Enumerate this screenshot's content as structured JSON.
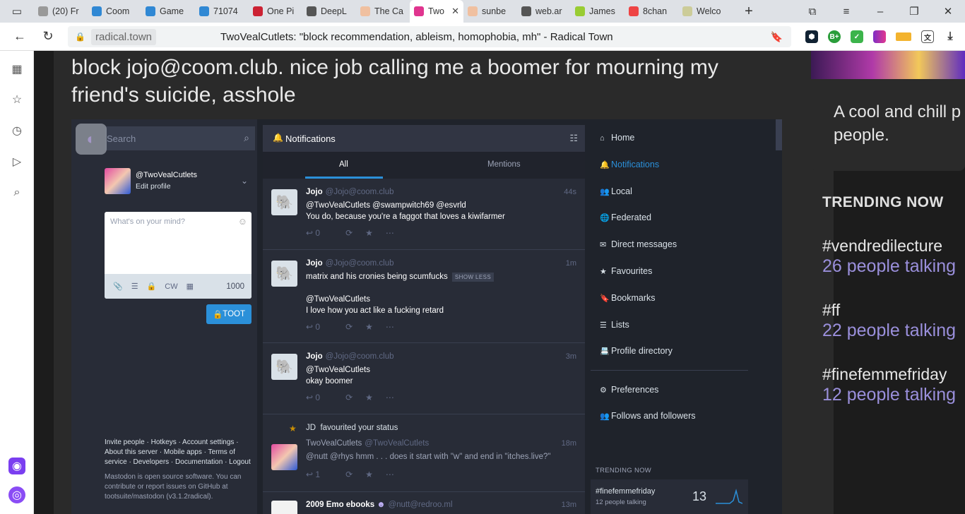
{
  "browser": {
    "tabs": [
      {
        "title": "(20) Fr",
        "color": "#999"
      },
      {
        "title": "Coom",
        "color": "#3088d4"
      },
      {
        "title": "Game",
        "color": "#3088d4"
      },
      {
        "title": "71074",
        "color": "#3088d4"
      },
      {
        "title": "One Pi",
        "color": "#c23"
      },
      {
        "title": "DeepL",
        "color": "#555"
      },
      {
        "title": "The Ca",
        "color": "#f0c0a0"
      },
      {
        "title": "Two",
        "color": "#e0358f"
      },
      {
        "title": "sunbe",
        "color": "#f0c0a0"
      },
      {
        "title": "web.ar",
        "color": "#555"
      },
      {
        "title": "James",
        "color": "#9c3"
      },
      {
        "title": "8chan",
        "color": "#e44"
      },
      {
        "title": "Welco",
        "color": "#cc9"
      }
    ],
    "url_domain": "radical.town",
    "page_title": "TwoVealCutlets: \"block recommendation, ableism, homophobia, mh\" - Radical Town"
  },
  "post": {
    "text": "block jojo@coom.club. nice job calling me a boomer for mourning my friend's suicide, asshole"
  },
  "mastodon": {
    "search_placeholder": "Search",
    "handle": "@TwoVealCutlets",
    "edit_profile": "Edit profile",
    "compose_placeholder": "What's on your mind?",
    "cw": "CW",
    "char_count": "1000",
    "toot_button": "TOOT",
    "footer_links": "Invite people · Hotkeys · Account settings · About this server · Mobile apps · Terms of service · Developers · Documentation · Logout",
    "footer_note": "Mastodon is open source software. You can contribute or report issues on GitHub at tootsuite/mastodon (v3.1.2radical).",
    "column_title": "Notifications",
    "tab_all": "All",
    "tab_mentions": "Mentions",
    "notifications": [
      {
        "name": "Jojo",
        "acct": "@Jojo@coom.club",
        "time": "44s",
        "line1": "@TwoVealCutlets @swampwitch69 @esvrld",
        "line2": "You do, because you're a faggot that loves a kiwifarmer",
        "replies": "0"
      },
      {
        "name": "Jojo",
        "acct": "@Jojo@coom.club",
        "time": "1m",
        "line1": "matrix and his cronies being scumfucks",
        "show_less": "SHOW LESS",
        "line2": "@TwoVealCutlets",
        "line3": "I love how you act like a fucking retard",
        "replies": "0"
      },
      {
        "name": "Jojo",
        "acct": "@Jojo@coom.club",
        "time": "3m",
        "line1": "@TwoVealCutlets",
        "line2": "okay boomer",
        "replies": "0"
      },
      {
        "fav_by": "JD",
        "fav_text": "favourited your status",
        "name": "TwoVealCutlets",
        "acct": "@TwoVealCutlets",
        "time": "18m",
        "line1": "@nutt @rhys hmm . . . does it start with \"w\" and end in \"itches.live?\"",
        "replies": "1"
      },
      {
        "name": "2009 Emo ebooks",
        "acct": "@nutt@redroo.ml",
        "time": "13m"
      }
    ],
    "nav": [
      {
        "label": "Home",
        "icon": "home-icon",
        "glyph": "⌂"
      },
      {
        "label": "Notifications",
        "icon": "bell-icon",
        "glyph": "🔔"
      },
      {
        "label": "Local",
        "icon": "users-icon",
        "glyph": "👥"
      },
      {
        "label": "Federated",
        "icon": "globe-icon",
        "glyph": "🌐"
      },
      {
        "label": "Direct messages",
        "icon": "envelope-icon",
        "glyph": "✉"
      },
      {
        "label": "Favourites",
        "icon": "star-icon",
        "glyph": "★"
      },
      {
        "label": "Bookmarks",
        "icon": "bookmark-icon",
        "glyph": "🔖"
      },
      {
        "label": "Lists",
        "icon": "list-icon",
        "glyph": "☰"
      },
      {
        "label": "Profile directory",
        "icon": "address-book-icon",
        "glyph": "📇"
      },
      {
        "label": "Preferences",
        "icon": "cog-icon",
        "glyph": "⚙"
      },
      {
        "label": "Follows and followers",
        "icon": "users-icon",
        "glyph": "👥"
      }
    ],
    "trending_header": "TRENDING NOW",
    "trending_tag": "#finefemmefriday",
    "trending_sub": "12 people talking",
    "trending_count": "13"
  },
  "sidebar_right": {
    "about_text": "A cool and chill p\npeople.",
    "trending_header": "TRENDING NOW",
    "trends": [
      {
        "tag": "#vendredilecture",
        "sub": "26 people talking"
      },
      {
        "tag": "#ff",
        "sub": "22 people talking"
      },
      {
        "tag": "#finefemmefriday",
        "sub": "12 people talking"
      }
    ]
  },
  "colors": {
    "accent": "#2b90d9",
    "trend_purple": "#9a8fdb"
  }
}
